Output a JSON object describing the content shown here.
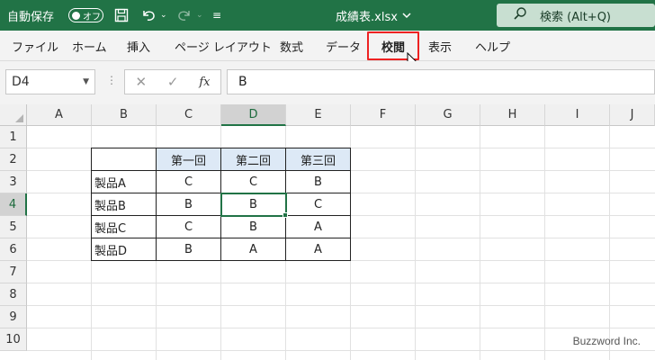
{
  "titlebar": {
    "autosave_label": "自動保存",
    "autosave_toggle": "オフ",
    "filename": "成績表.xlsx",
    "search_placeholder": "検索 (Alt+Q)",
    "bg_color": "#217346"
  },
  "ribbon": {
    "tabs": [
      "ファイル",
      "ホーム",
      "挿入",
      "ページ レイアウト",
      "数式",
      "データ",
      "校閲",
      "表示",
      "ヘルプ"
    ],
    "highlighted_tab": "校閲",
    "highlight_color": "#ee2222"
  },
  "formula_bar": {
    "name_box": "D4",
    "formula_value": "B",
    "fx_label": "fx"
  },
  "sheet": {
    "columns": [
      "A",
      "B",
      "C",
      "D",
      "E",
      "F",
      "G",
      "H",
      "I",
      "J"
    ],
    "rows": [
      "1",
      "2",
      "3",
      "4",
      "5",
      "6",
      "7",
      "8",
      "9",
      "10"
    ],
    "active_cell": "D4",
    "table": {
      "headers": [
        "",
        "第一回",
        "第二回",
        "第三回"
      ],
      "rows": [
        [
          "製品A",
          "C",
          "C",
          "B"
        ],
        [
          "製品B",
          "B",
          "B",
          "C"
        ],
        [
          "製品C",
          "C",
          "B",
          "A"
        ],
        [
          "製品D",
          "B",
          "A",
          "A"
        ]
      ],
      "header_color": "#dde9f6"
    }
  },
  "watermark": "Buzzword Inc."
}
